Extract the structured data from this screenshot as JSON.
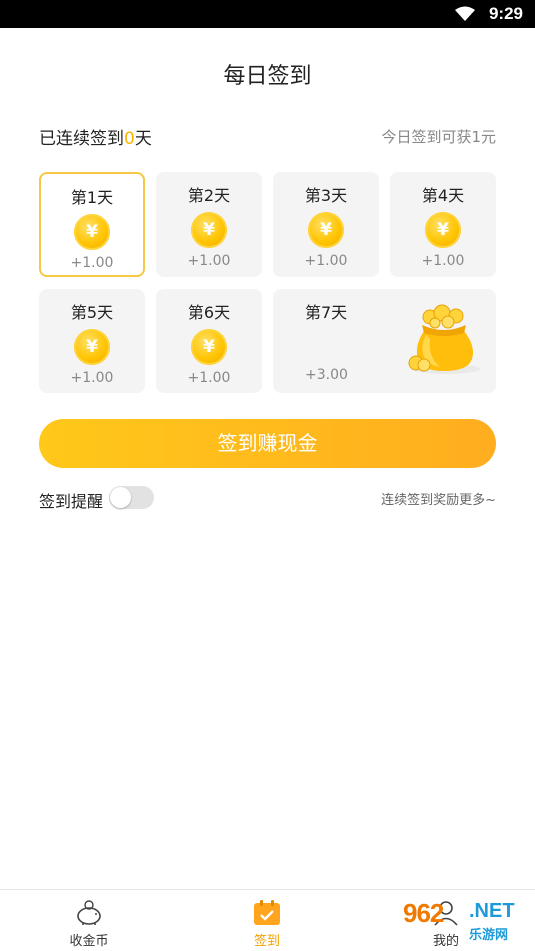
{
  "status_bar": {
    "time": "9:29"
  },
  "page": {
    "title": "每日签到"
  },
  "streak": {
    "prefix": "已连续签到",
    "count": "0",
    "suffix": "天"
  },
  "today_reward": "今日签到可获1元",
  "days": [
    {
      "label": "第1天",
      "amount": "+1.00",
      "active": true
    },
    {
      "label": "第2天",
      "amount": "+1.00",
      "active": false
    },
    {
      "label": "第3天",
      "amount": "+1.00",
      "active": false
    },
    {
      "label": "第4天",
      "amount": "+1.00",
      "active": false
    },
    {
      "label": "第5天",
      "amount": "+1.00",
      "active": false
    },
    {
      "label": "第6天",
      "amount": "+1.00",
      "active": false
    },
    {
      "label": "第7天",
      "amount": "+3.00",
      "active": false
    }
  ],
  "coin_symbol": "¥",
  "sign_button": {
    "label": "签到赚现金"
  },
  "reminder": {
    "label": "签到提醒",
    "enabled": false
  },
  "more_link": "连续签到奖励更多~",
  "tabs": [
    {
      "label": "收金币",
      "icon": "piggy-bank-icon",
      "active": false
    },
    {
      "label": "签到",
      "icon": "calendar-check-icon",
      "active": true
    },
    {
      "label": "我的",
      "icon": "user-icon",
      "active": false
    }
  ],
  "watermark": {
    "logo": "962",
    "net": ".NET",
    "sub": "乐游网"
  },
  "colors": {
    "accent": "#f7b500",
    "button_start": "#ffc81a",
    "button_end": "#ffad1f",
    "active_border": "#f7c843"
  }
}
